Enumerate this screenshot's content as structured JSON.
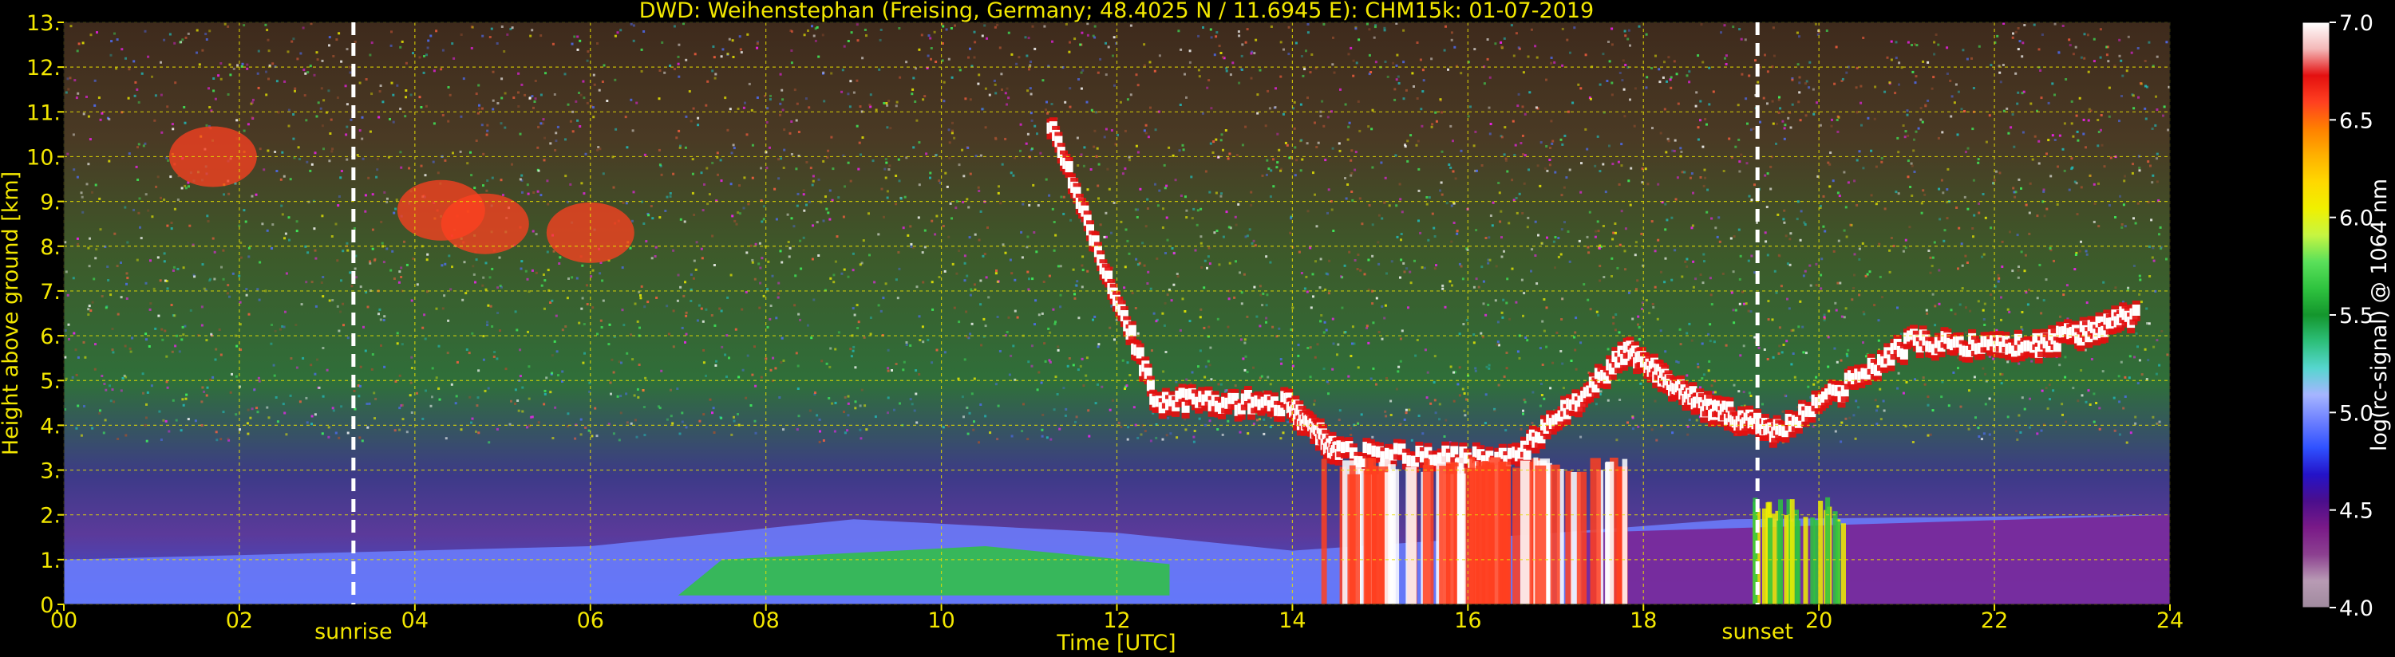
{
  "chart_data": {
    "type": "heatmap",
    "title": "DWD: Weihenstephan (Freising, Germany; 48.4025 N / 11.6945 E):    CHM15k: 01-07-2019",
    "xlabel": "Time [UTC]",
    "ylabel": "Height above ground [km]",
    "xlim": [
      0,
      24
    ],
    "ylim": [
      0,
      13
    ],
    "x_ticks": [
      0,
      2,
      4,
      6,
      8,
      10,
      12,
      14,
      16,
      18,
      20,
      22,
      24
    ],
    "x_tick_labels": [
      "00",
      "02",
      "04",
      "06",
      "08",
      "10",
      "12",
      "14",
      "16",
      "18",
      "20",
      "22",
      "24"
    ],
    "y_ticks": [
      0,
      1,
      2,
      3,
      4,
      5,
      6,
      7,
      8,
      9,
      10,
      11,
      12,
      13
    ],
    "y_tick_labels": [
      "0.",
      "1.",
      "2.",
      "3.",
      "4.",
      "5.",
      "6.",
      "7.",
      "8.",
      "9.",
      "10.",
      "11.",
      "12.",
      "13."
    ],
    "grid": true,
    "annotations": [
      {
        "text": "sunrise",
        "x": 3.3
      },
      {
        "text": "sunset",
        "x": 19.3
      }
    ],
    "colorbar": {
      "label": "log(rc-signal) @ 1064 nm",
      "range": [
        4.0,
        7.0
      ],
      "ticks": [
        4.0,
        4.5,
        5.0,
        5.5,
        6.0,
        6.5,
        7.0
      ],
      "tick_labels": [
        "4.0",
        "4.5",
        "5.0",
        "5.5",
        "6.0",
        "6.5",
        "7.0"
      ]
    },
    "layers": [
      {
        "name": "boundary layer",
        "x": [
          0,
          6,
          9,
          12,
          14,
          17,
          19,
          24
        ],
        "y": [
          1.0,
          1.3,
          1.9,
          1.6,
          1.2,
          1.6,
          1.9,
          2.0
        ]
      },
      {
        "name": "cloud layer",
        "x": [
          11.2,
          12.4,
          13.9,
          14.5,
          16.5,
          17.8,
          18.6,
          19.5,
          21,
          22.4,
          23.6
        ],
        "y": [
          10.8,
          4.6,
          4.5,
          3.4,
          3.3,
          5.7,
          4.5,
          3.9,
          5.9,
          5.8,
          6.5
        ]
      }
    ],
    "colors": {
      "axis_text": "#f2e600",
      "grid": "#e8e000",
      "background": "#000000",
      "marker_line": "#ffffff"
    },
    "colormap": [
      "#a08a9e",
      "#b89bb4",
      "#8c4090",
      "#7a1a88",
      "#4b0e8c",
      "#2413c8",
      "#2f51ff",
      "#6c7fff",
      "#a6b5ff",
      "#56d6cf",
      "#2dbf7a",
      "#14962d",
      "#2fc33f",
      "#5ae05a",
      "#c6f542",
      "#f0f000",
      "#ffd800",
      "#ffb000",
      "#ff8000",
      "#ff4020",
      "#e41010",
      "#f4b8b8",
      "#ffffff"
    ]
  }
}
